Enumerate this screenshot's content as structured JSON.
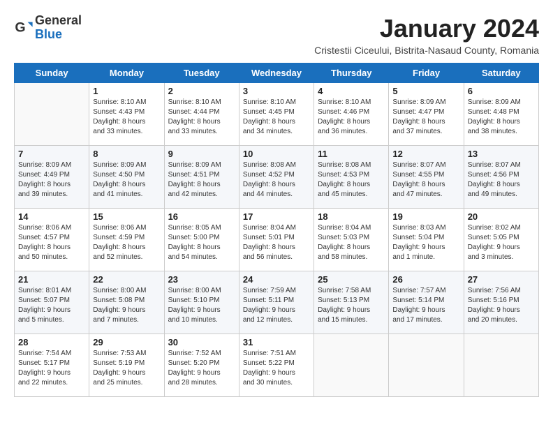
{
  "header": {
    "logo_line1": "General",
    "logo_line2": "Blue",
    "title": "January 2024",
    "subtitle": "Cristestii Ciceului, Bistrita-Nasaud County, Romania"
  },
  "weekdays": [
    "Sunday",
    "Monday",
    "Tuesday",
    "Wednesday",
    "Thursday",
    "Friday",
    "Saturday"
  ],
  "weeks": [
    [
      {
        "day": "",
        "info": ""
      },
      {
        "day": "1",
        "info": "Sunrise: 8:10 AM\nSunset: 4:43 PM\nDaylight: 8 hours\nand 33 minutes."
      },
      {
        "day": "2",
        "info": "Sunrise: 8:10 AM\nSunset: 4:44 PM\nDaylight: 8 hours\nand 33 minutes."
      },
      {
        "day": "3",
        "info": "Sunrise: 8:10 AM\nSunset: 4:45 PM\nDaylight: 8 hours\nand 34 minutes."
      },
      {
        "day": "4",
        "info": "Sunrise: 8:10 AM\nSunset: 4:46 PM\nDaylight: 8 hours\nand 36 minutes."
      },
      {
        "day": "5",
        "info": "Sunrise: 8:09 AM\nSunset: 4:47 PM\nDaylight: 8 hours\nand 37 minutes."
      },
      {
        "day": "6",
        "info": "Sunrise: 8:09 AM\nSunset: 4:48 PM\nDaylight: 8 hours\nand 38 minutes."
      }
    ],
    [
      {
        "day": "7",
        "info": "Sunrise: 8:09 AM\nSunset: 4:49 PM\nDaylight: 8 hours\nand 39 minutes."
      },
      {
        "day": "8",
        "info": "Sunrise: 8:09 AM\nSunset: 4:50 PM\nDaylight: 8 hours\nand 41 minutes."
      },
      {
        "day": "9",
        "info": "Sunrise: 8:09 AM\nSunset: 4:51 PM\nDaylight: 8 hours\nand 42 minutes."
      },
      {
        "day": "10",
        "info": "Sunrise: 8:08 AM\nSunset: 4:52 PM\nDaylight: 8 hours\nand 44 minutes."
      },
      {
        "day": "11",
        "info": "Sunrise: 8:08 AM\nSunset: 4:53 PM\nDaylight: 8 hours\nand 45 minutes."
      },
      {
        "day": "12",
        "info": "Sunrise: 8:07 AM\nSunset: 4:55 PM\nDaylight: 8 hours\nand 47 minutes."
      },
      {
        "day": "13",
        "info": "Sunrise: 8:07 AM\nSunset: 4:56 PM\nDaylight: 8 hours\nand 49 minutes."
      }
    ],
    [
      {
        "day": "14",
        "info": "Sunrise: 8:06 AM\nSunset: 4:57 PM\nDaylight: 8 hours\nand 50 minutes."
      },
      {
        "day": "15",
        "info": "Sunrise: 8:06 AM\nSunset: 4:59 PM\nDaylight: 8 hours\nand 52 minutes."
      },
      {
        "day": "16",
        "info": "Sunrise: 8:05 AM\nSunset: 5:00 PM\nDaylight: 8 hours\nand 54 minutes."
      },
      {
        "day": "17",
        "info": "Sunrise: 8:04 AM\nSunset: 5:01 PM\nDaylight: 8 hours\nand 56 minutes."
      },
      {
        "day": "18",
        "info": "Sunrise: 8:04 AM\nSunset: 5:03 PM\nDaylight: 8 hours\nand 58 minutes."
      },
      {
        "day": "19",
        "info": "Sunrise: 8:03 AM\nSunset: 5:04 PM\nDaylight: 9 hours\nand 1 minute."
      },
      {
        "day": "20",
        "info": "Sunrise: 8:02 AM\nSunset: 5:05 PM\nDaylight: 9 hours\nand 3 minutes."
      }
    ],
    [
      {
        "day": "21",
        "info": "Sunrise: 8:01 AM\nSunset: 5:07 PM\nDaylight: 9 hours\nand 5 minutes."
      },
      {
        "day": "22",
        "info": "Sunrise: 8:00 AM\nSunset: 5:08 PM\nDaylight: 9 hours\nand 7 minutes."
      },
      {
        "day": "23",
        "info": "Sunrise: 8:00 AM\nSunset: 5:10 PM\nDaylight: 9 hours\nand 10 minutes."
      },
      {
        "day": "24",
        "info": "Sunrise: 7:59 AM\nSunset: 5:11 PM\nDaylight: 9 hours\nand 12 minutes."
      },
      {
        "day": "25",
        "info": "Sunrise: 7:58 AM\nSunset: 5:13 PM\nDaylight: 9 hours\nand 15 minutes."
      },
      {
        "day": "26",
        "info": "Sunrise: 7:57 AM\nSunset: 5:14 PM\nDaylight: 9 hours\nand 17 minutes."
      },
      {
        "day": "27",
        "info": "Sunrise: 7:56 AM\nSunset: 5:16 PM\nDaylight: 9 hours\nand 20 minutes."
      }
    ],
    [
      {
        "day": "28",
        "info": "Sunrise: 7:54 AM\nSunset: 5:17 PM\nDaylight: 9 hours\nand 22 minutes."
      },
      {
        "day": "29",
        "info": "Sunrise: 7:53 AM\nSunset: 5:19 PM\nDaylight: 9 hours\nand 25 minutes."
      },
      {
        "day": "30",
        "info": "Sunrise: 7:52 AM\nSunset: 5:20 PM\nDaylight: 9 hours\nand 28 minutes."
      },
      {
        "day": "31",
        "info": "Sunrise: 7:51 AM\nSunset: 5:22 PM\nDaylight: 9 hours\nand 30 minutes."
      },
      {
        "day": "",
        "info": ""
      },
      {
        "day": "",
        "info": ""
      },
      {
        "day": "",
        "info": ""
      }
    ]
  ]
}
